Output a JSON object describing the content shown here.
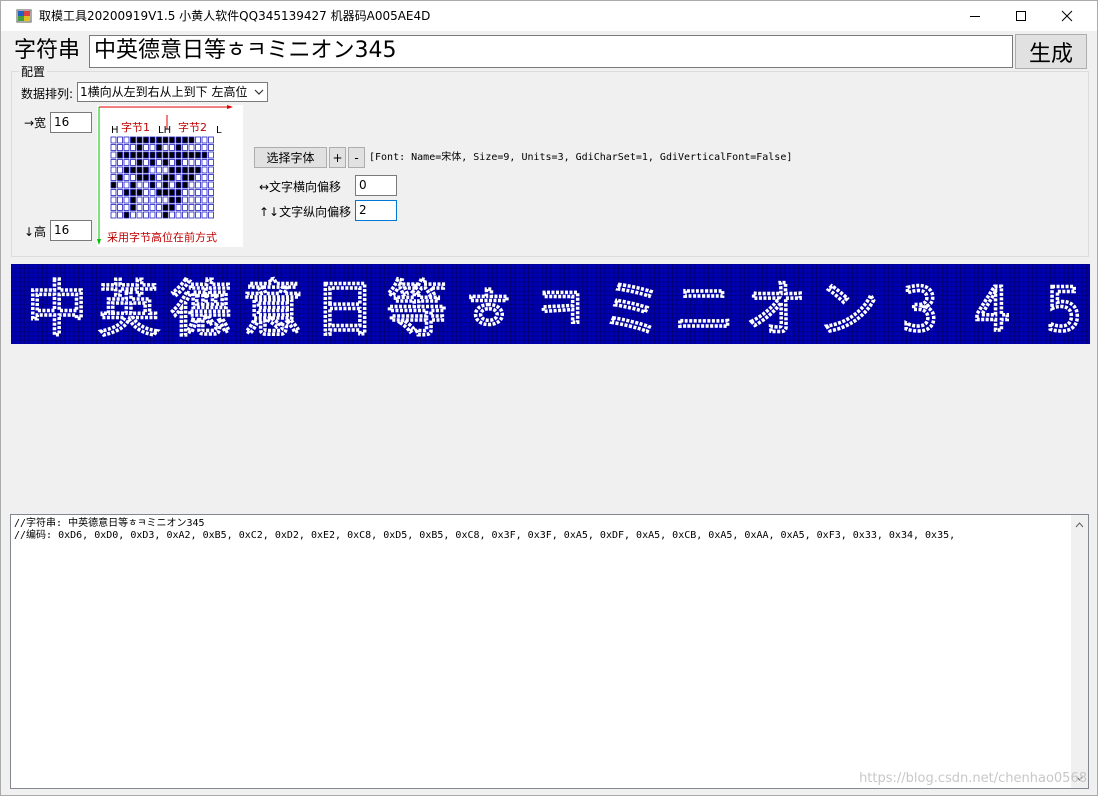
{
  "window": {
    "title": "取模工具20200919V1.5  小黄人软件QQ345139427 机器码A005AE4D"
  },
  "string_label": "字符串",
  "string_value": "中英德意日等ㅎㅋミニオン345",
  "generate_label": "生成",
  "config": {
    "group_label": "配置",
    "arrange_label": "数据排列:",
    "arrange_value": "1横向从左到右从上到下 左高位",
    "width_label": "→宽",
    "width_value": "16",
    "height_label": "↓高",
    "height_value": "16",
    "diagram": {
      "byte1": "字节1",
      "byte2": "字节2",
      "h": "H",
      "l": "L",
      "lh": "LH",
      "caption": "采用字节高位在前方式"
    },
    "select_font_label": "选择字体",
    "plus_label": "+",
    "minus_label": "-",
    "font_info": "[Font: Name=宋体, Size=9, Units=3, GdiCharSet=1, GdiVerticalFont=False]",
    "h_offset_label": "↔文字横向偏移",
    "h_offset_value": "0",
    "v_offset_label": "↑↓文字纵向偏移",
    "v_offset_value": "2"
  },
  "preview": {
    "chars": [
      "中",
      "英",
      "德",
      "意",
      "日",
      "等",
      "ㅎ",
      "ㅋ",
      "ミ",
      "ニ",
      "オ",
      "ン",
      "3",
      "4",
      "5"
    ],
    "bg_color": "#0000b0",
    "pixel_color": "#ffffff"
  },
  "output": {
    "line1": "//字符串: 中英德意日等ㅎㅋミニオン345",
    "line2": "//编码: 0xD6, 0xD0, 0xD3, 0xA2, 0xB5, 0xC2, 0xD2, 0xE2, 0xC8, 0xD5, 0xB5, 0xC8, 0x3F, 0x3F, 0xA5, 0xDF, 0xA5, 0xCB, 0xA5, 0xAA, 0xA5, 0xF3, 0x33, 0x34, 0x35,"
  },
  "watermark": "https://blog.csdn.net/chenhao0568"
}
